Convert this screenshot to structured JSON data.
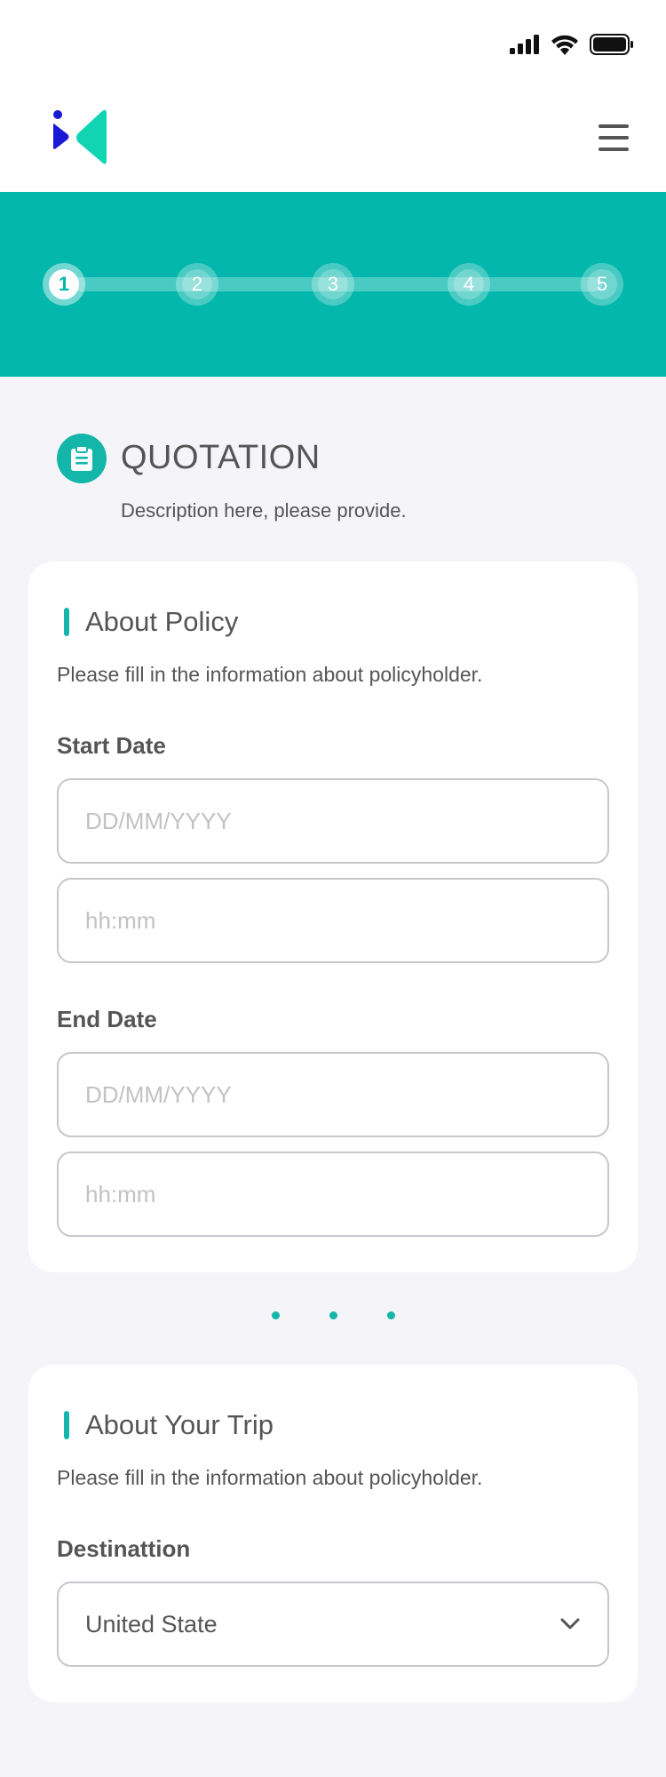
{
  "colors": {
    "accent": "#03b7ac",
    "text": "#555555",
    "placeholder": "#c2c2c2",
    "background": "#f4f4f9",
    "logo_blue": "#1a1ad6",
    "logo_teal": "#11d4b3"
  },
  "status_bar": {
    "icons": [
      "signal-icon",
      "wifi-icon",
      "battery-icon"
    ]
  },
  "header": {
    "logo_icon": "brand-logo",
    "menu_icon": "hamburger-menu-icon"
  },
  "stepper": {
    "current": 1,
    "steps": [
      "1",
      "2",
      "3",
      "4",
      "5"
    ]
  },
  "page": {
    "icon": "clipboard-icon",
    "title": "QUOTATION",
    "description": "Description here, please provide."
  },
  "policy_card": {
    "title": "About Policy",
    "subtitle": "Please fill in the information about policyholder.",
    "start_date": {
      "label": "Start Date",
      "date_placeholder": "DD/MM/YYYY",
      "time_placeholder": "hh:mm"
    },
    "end_date": {
      "label": "End Date",
      "date_placeholder": "DD/MM/YYYY",
      "time_placeholder": "hh:mm"
    }
  },
  "pagination_dots": 3,
  "trip_card": {
    "title": "About Your Trip",
    "subtitle": "Please fill in the information about policyholder.",
    "destination": {
      "label": "Destinattion",
      "value": "United State",
      "icon": "chevron-down-icon"
    }
  }
}
